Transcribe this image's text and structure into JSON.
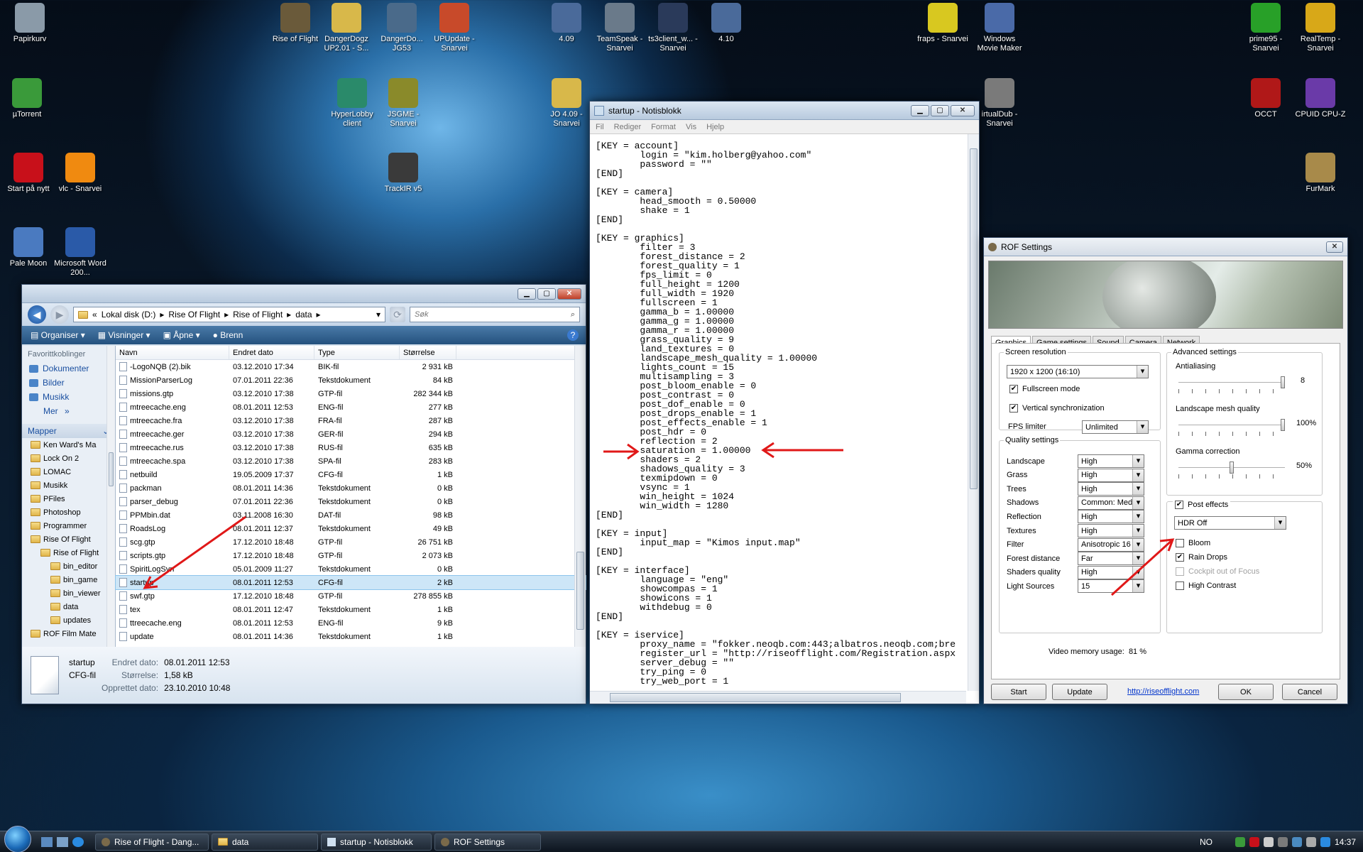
{
  "desktop": {
    "icons": [
      {
        "label": "Papirkurv",
        "color": "#8a9aa8"
      },
      {
        "label": "µTorrent",
        "color": "#3a9a3a"
      },
      {
        "label": "Start på nytt",
        "color": "#c8101a"
      },
      {
        "label": "vlc - Snarvei",
        "color": "#f08a10"
      },
      {
        "label": "Pale Moon",
        "color": "#4a7ac0"
      },
      {
        "label": "Microsoft Word 200...",
        "color": "#2a5aa8"
      },
      {
        "label": "Rise of Flight",
        "color": "#6a5a3a"
      },
      {
        "label": "DangerDogz UP2.01 - S...",
        "color": "#d8b84a"
      },
      {
        "label": "DangerDo... JG53",
        "color": "#4a6a8a"
      },
      {
        "label": "UPUpdate - Snarvei",
        "color": "#c84a2a"
      },
      {
        "label": "HyperLobby client",
        "color": "#2a8a6a"
      },
      {
        "label": "JSGME - Snarvei",
        "color": "#8a8a2a"
      },
      {
        "label": "TrackIR v5",
        "color": "#3a3a3a"
      },
      {
        "label": "4.09",
        "color": "#4a6a9a"
      },
      {
        "label": "TeamSpeak - Snarvei",
        "color": "#6a7a8a"
      },
      {
        "label": "ts3client_w... - Snarvei",
        "color": "#2a3a5a"
      },
      {
        "label": "4.10",
        "color": "#4a6a9a"
      },
      {
        "label": "JO 4.09 - Snarvei",
        "color": "#d8b84a"
      },
      {
        "label": "fraps - Snarvei",
        "color": "#d8c820"
      },
      {
        "label": "Windows Movie Maker",
        "color": "#4a6aa8"
      },
      {
        "label": "irtualDub - Snarvei",
        "color": "#7a7a7a"
      },
      {
        "label": "prime95 - Snarvei",
        "color": "#28a028"
      },
      {
        "label": "RealTemp - Snarvei",
        "color": "#d8a818"
      },
      {
        "label": "OCCT",
        "color": "#b01818"
      },
      {
        "label": "CPUID CPU-Z",
        "color": "#6a3aa8"
      },
      {
        "label": "FurMark",
        "color": "#a88a4a"
      }
    ]
  },
  "explorer": {
    "title": "data",
    "path": [
      "Lokal disk (D:)",
      "Rise Of Flight",
      "Rise of Flight",
      "data"
    ],
    "search_placeholder": "Søk",
    "commands": [
      "Organiser",
      "Visninger",
      "Åpne",
      "Brenn"
    ],
    "fav_header": "Favorittkoblinger",
    "favorites": [
      "Dokumenter",
      "Bilder",
      "Musikk"
    ],
    "more": "Mer",
    "folders_header": "Mapper",
    "tree": [
      {
        "label": "Ken Ward's Ma",
        "indent": 0
      },
      {
        "label": "Lock On 2",
        "indent": 0
      },
      {
        "label": "LOMAC",
        "indent": 0
      },
      {
        "label": "Musikk",
        "indent": 0
      },
      {
        "label": "PFiles",
        "indent": 0
      },
      {
        "label": "Photoshop",
        "indent": 0
      },
      {
        "label": "Programmer",
        "indent": 0
      },
      {
        "label": "Rise Of Flight",
        "indent": 0
      },
      {
        "label": "Rise of Flight",
        "indent": 1
      },
      {
        "label": "bin_editor",
        "indent": 2
      },
      {
        "label": "bin_game",
        "indent": 2
      },
      {
        "label": "bin_viewer",
        "indent": 2
      },
      {
        "label": "data",
        "indent": 2
      },
      {
        "label": "updates",
        "indent": 2
      },
      {
        "label": "ROF Film Mate",
        "indent": 0
      }
    ],
    "columns": [
      "Navn",
      "Endret dato",
      "Type",
      "Størrelse"
    ],
    "files": [
      {
        "name": "-LogoNQB (2).bik",
        "date": "03.12.2010 17:34",
        "type": "BIK-fil",
        "size": "2 931 kB"
      },
      {
        "name": "MissionParserLog",
        "date": "07.01.2011 22:36",
        "type": "Tekstdokument",
        "size": "84 kB"
      },
      {
        "name": "missions.gtp",
        "date": "03.12.2010 17:38",
        "type": "GTP-fil",
        "size": "282 344 kB"
      },
      {
        "name": "mtreecache.eng",
        "date": "08.01.2011 12:53",
        "type": "ENG-fil",
        "size": "277 kB"
      },
      {
        "name": "mtreecache.fra",
        "date": "03.12.2010 17:38",
        "type": "FRA-fil",
        "size": "287 kB"
      },
      {
        "name": "mtreecache.ger",
        "date": "03.12.2010 17:38",
        "type": "GER-fil",
        "size": "294 kB"
      },
      {
        "name": "mtreecache.rus",
        "date": "03.12.2010 17:38",
        "type": "RUS-fil",
        "size": "635 kB"
      },
      {
        "name": "mtreecache.spa",
        "date": "03.12.2010 17:38",
        "type": "SPA-fil",
        "size": "283 kB"
      },
      {
        "name": "netbuild",
        "date": "19.05.2009 17:37",
        "type": "CFG-fil",
        "size": "1 kB"
      },
      {
        "name": "packman",
        "date": "08.01.2011 14:36",
        "type": "Tekstdokument",
        "size": "0 kB"
      },
      {
        "name": "parser_debug",
        "date": "07.01.2011 22:36",
        "type": "Tekstdokument",
        "size": "0 kB"
      },
      {
        "name": "PPMbin.dat",
        "date": "03.11.2008 16:30",
        "type": "DAT-fil",
        "size": "98 kB"
      },
      {
        "name": "RoadsLog",
        "date": "08.01.2011 12:37",
        "type": "Tekstdokument",
        "size": "49 kB"
      },
      {
        "name": "scg.gtp",
        "date": "17.12.2010 18:48",
        "type": "GTP-fil",
        "size": "26 751 kB"
      },
      {
        "name": "scripts.gtp",
        "date": "17.12.2010 18:48",
        "type": "GTP-fil",
        "size": "2 073 kB"
      },
      {
        "name": "SpiritLogSvn",
        "date": "05.01.2009 11:27",
        "type": "Tekstdokument",
        "size": "0 kB"
      },
      {
        "name": "startup",
        "date": "08.01.2011 12:53",
        "type": "CFG-fil",
        "size": "2 kB"
      },
      {
        "name": "swf.gtp",
        "date": "17.12.2010 18:48",
        "type": "GTP-fil",
        "size": "278 855 kB"
      },
      {
        "name": "tex",
        "date": "08.01.2011 12:47",
        "type": "Tekstdokument",
        "size": "1 kB"
      },
      {
        "name": "ttreecache.eng",
        "date": "08.01.2011 12:53",
        "type": "ENG-fil",
        "size": "9 kB"
      },
      {
        "name": "update",
        "date": "08.01.2011 14:36",
        "type": "Tekstdokument",
        "size": "1 kB"
      }
    ],
    "selected_index": 16,
    "details": {
      "name": "startup",
      "type": "CFG-fil",
      "modified_label": "Endret dato:",
      "modified": "08.01.2011 12:53",
      "size_label": "Størrelse:",
      "size": "1,58 kB",
      "created_label": "Opprettet dato:",
      "created": "23.10.2010 10:48"
    }
  },
  "notepad": {
    "title": "startup - Notisblokk",
    "menu": [
      "Fil",
      "Rediger",
      "Format",
      "Vis",
      "Hjelp"
    ],
    "text": "[KEY = account]\n        login = \"kim.holberg@yahoo.com\"\n        password = \"\"\n[END]\n\n[KEY = camera]\n        head_smooth = 0.50000\n        shake = 1\n[END]\n\n[KEY = graphics]\n        filter = 3\n        forest_distance = 2\n        forest_quality = 1\n        fps_limit = 0\n        full_height = 1200\n        full_width = 1920\n        fullscreen = 1\n        gamma_b = 1.00000\n        gamma_g = 1.00000\n        gamma_r = 1.00000\n        grass_quality = 9\n        land_textures = 0\n        landscape_mesh_quality = 1.00000\n        lights_count = 15\n        multisampling = 3\n        post_bloom_enable = 0\n        post_contrast = 0\n        post_dof_enable = 0\n        post_drops_enable = 1\n        post_effects_enable = 1\n        post_hdr = 0\n        reflection = 2\n        saturation = 1.00000\n        shaders = 2\n        shadows_quality = 3\n        texmipdown = 0\n        vsync = 1\n        win_height = 1024\n        win_width = 1280\n[END]\n\n[KEY = input]\n        input_map = \"Kimos input.map\"\n[END]\n\n[KEY = interface]\n        language = \"eng\"\n        showcompas = 1\n        showicons = 1\n        withdebug = 0\n[END]\n\n[KEY = iservice]\n        proxy_name = \"fokker.neoqb.com:443;albatros.neoqb.com;bre\n        register_url = \"http://riseofflight.com/Registration.aspx\n        server_debug = \"\"\n        try_ping = 0\n        try_web_port = 1"
  },
  "rof": {
    "title": "ROF Settings",
    "tabs": [
      "Graphics",
      "Game settings",
      "Sound",
      "Camera",
      "Network"
    ],
    "screen_legend": "Screen resolution",
    "resolution": "1920 x 1200  (16:10)",
    "fullscreen_label": "Fullscreen mode",
    "fullscreen": true,
    "vsync_label": "Vertical synchronization",
    "vsync": true,
    "fps_label": "FPS limiter",
    "fps_value": "Unlimited",
    "quality_legend": "Quality settings",
    "quality": [
      {
        "label": "Landscape",
        "value": "High"
      },
      {
        "label": "Grass",
        "value": "High"
      },
      {
        "label": "Trees",
        "value": "High"
      },
      {
        "label": "Shadows",
        "value": "Common: Med"
      },
      {
        "label": "Reflection",
        "value": "High"
      },
      {
        "label": "Textures",
        "value": "High"
      },
      {
        "label": "Filter",
        "value": "Anisotropic 16"
      },
      {
        "label": "Forest distance",
        "value": "Far"
      },
      {
        "label": "Shaders quality",
        "value": "High"
      },
      {
        "label": "Light Sources",
        "value": "15"
      }
    ],
    "advanced_legend": "Advanced settings",
    "antialiasing_label": "Antialiasing",
    "antialiasing_value": "8",
    "antialiasing_level": 1.0,
    "mesh_label": "Landscape mesh quality",
    "mesh_value": "100%",
    "mesh_level": 1.0,
    "gamma_label": "Gamma correction",
    "gamma_value": "50%",
    "gamma_level": 0.5,
    "post_label": "Post effects",
    "post": true,
    "hdr_value": "HDR Off",
    "effects": [
      {
        "label": "Bloom",
        "checked": false,
        "disabled": false
      },
      {
        "label": "Rain Drops",
        "checked": true,
        "disabled": false
      },
      {
        "label": "Cockpit out of Focus",
        "checked": false,
        "disabled": true
      },
      {
        "label": "High Contrast",
        "checked": false,
        "disabled": false
      }
    ],
    "vram_label": "Video memory usage:",
    "vram_value": "81 %",
    "buttons": {
      "start": "Start",
      "update": "Update",
      "link": "http://riseofflight.com",
      "ok": "OK",
      "cancel": "Cancel"
    }
  },
  "taskbar": {
    "items": [
      "Rise of Flight - Dang...",
      "data",
      "startup - Notisblokk",
      "ROF Settings"
    ],
    "lang": "NO",
    "clock": "14:37"
  }
}
